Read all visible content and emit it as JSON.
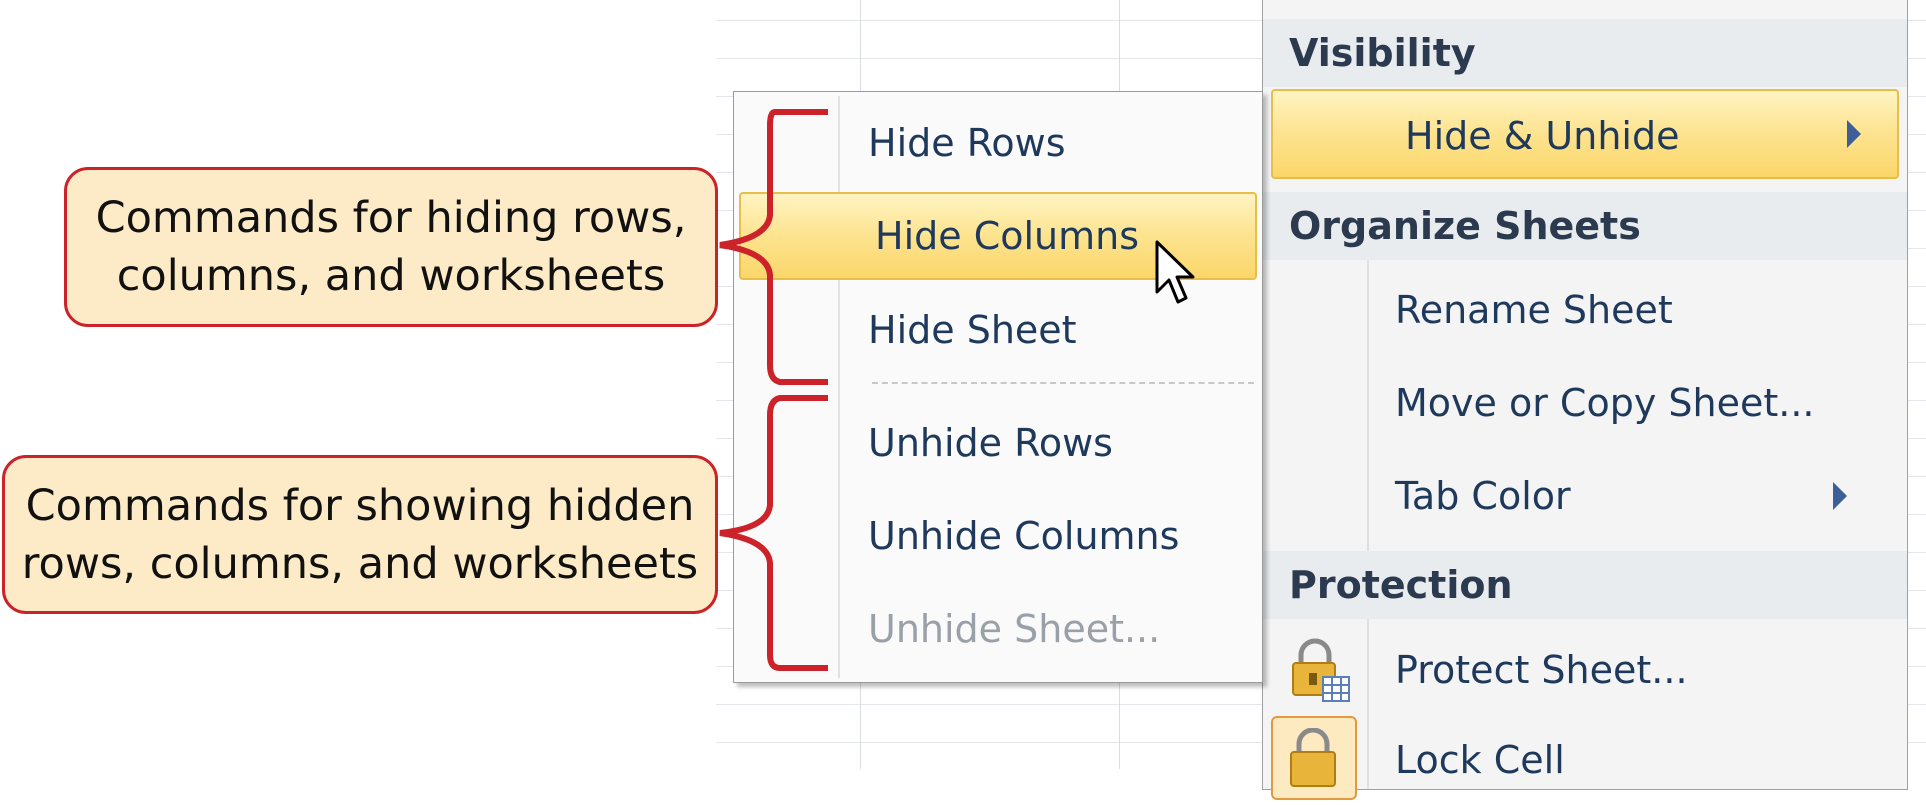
{
  "colors": {
    "callout_fill": "#fdebc8",
    "callout_border": "#cc2229",
    "highlight": "#fde38f",
    "menu_text": "#1e395b",
    "disabled_text": "#9aa0a8"
  },
  "main_menu": {
    "sections": [
      {
        "label": "Visibility"
      },
      {
        "label": "Organize Sheets"
      },
      {
        "label": "Protection"
      }
    ],
    "items": [
      {
        "label": "Hide & Unhide",
        "has_submenu": true,
        "highlighted": true
      },
      {
        "label": "Rename Sheet"
      },
      {
        "label": "Move or Copy Sheet..."
      },
      {
        "label": "Tab Color",
        "has_submenu": true
      },
      {
        "label": "Protect Sheet...",
        "icon": "lock-sheet-icon"
      },
      {
        "label": "Lock Cell",
        "icon": "lock-icon"
      }
    ]
  },
  "submenu": {
    "items": [
      {
        "label": "Hide Rows"
      },
      {
        "label": "Hide Columns",
        "highlighted": true
      },
      {
        "label": "Hide Sheet"
      },
      {
        "label": "Unhide Rows"
      },
      {
        "label": "Unhide Columns"
      },
      {
        "label": "Unhide Sheet...",
        "disabled": true
      }
    ]
  },
  "callouts": {
    "hide": {
      "line1": "Commands for hiding rows,",
      "line2": "columns, and worksheets"
    },
    "show": {
      "line1": "Commands for showing hidden",
      "line2": "rows, columns, and worksheets"
    }
  },
  "icons": [
    "cursor-arrow-icon",
    "submenu-arrow-icon",
    "lock-sheet-icon",
    "lock-icon"
  ]
}
